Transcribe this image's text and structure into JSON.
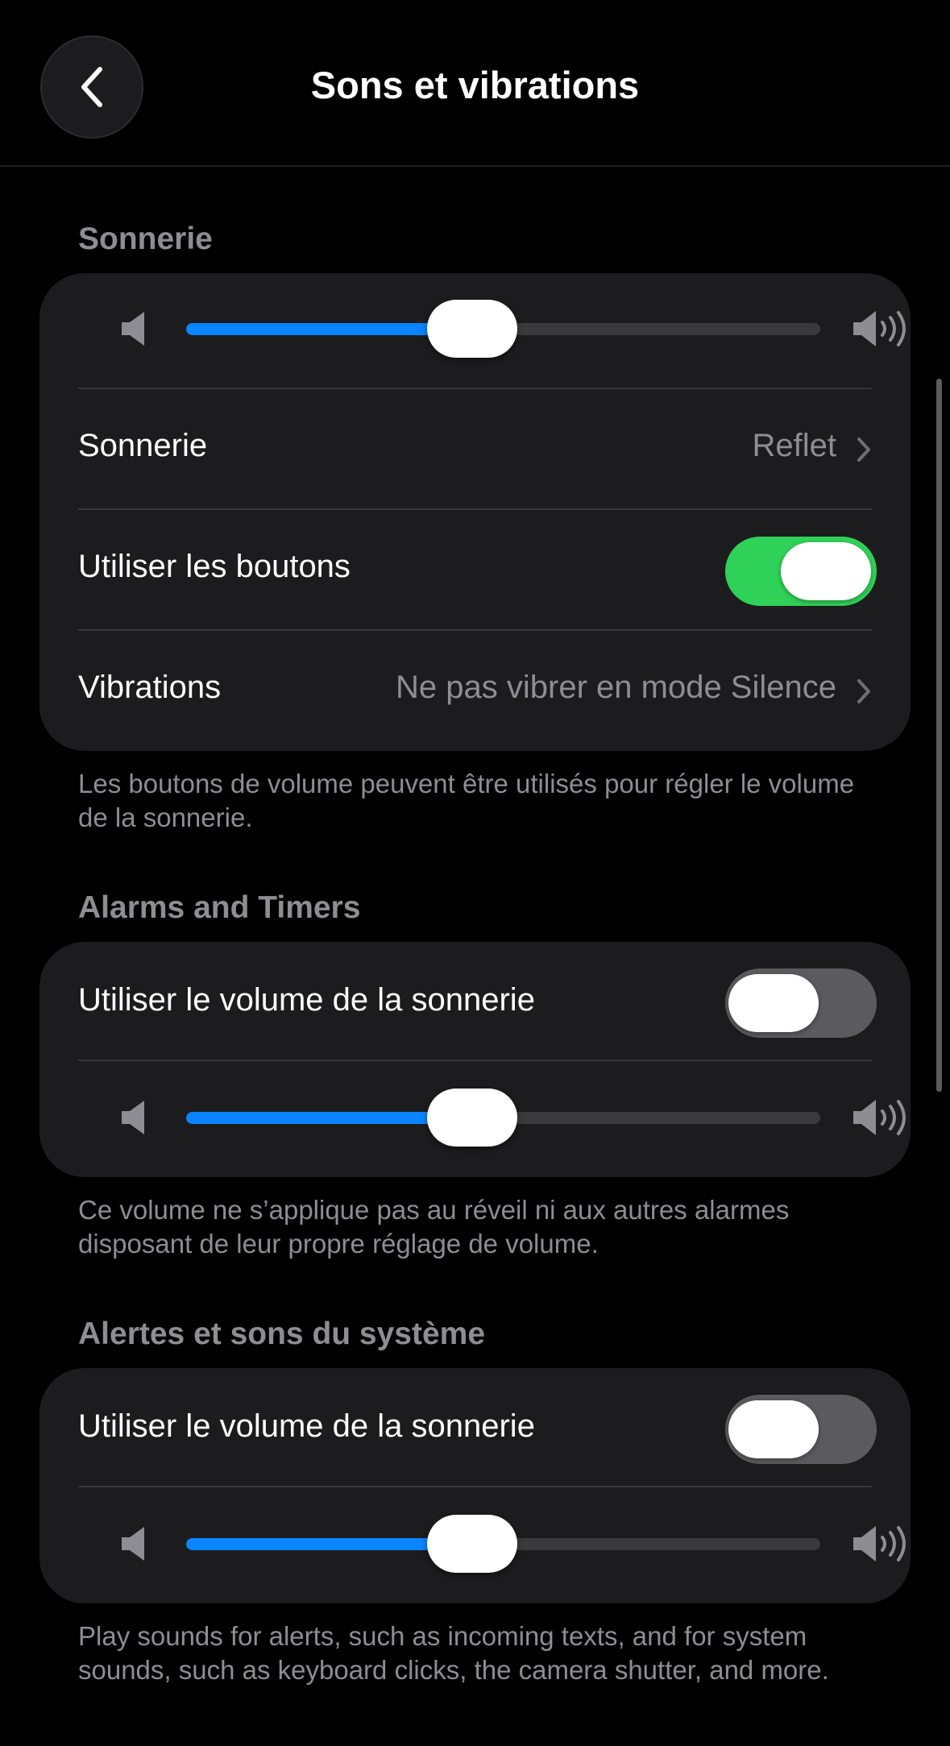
{
  "header": {
    "title": "Sons et vibrations",
    "back_icon": "chevron-left-icon"
  },
  "ringer": {
    "section_label": "Sonnerie",
    "volume_level": 0.38,
    "ringtone_label": "Sonnerie",
    "ringtone_value": "Reflet",
    "use_buttons_label": "Utiliser les boutons",
    "use_buttons_on": true,
    "vibrations_label": "Vibrations",
    "vibrations_value": "Ne pas vibrer en mode Silence",
    "footer": "Les boutons de volume peuvent être utilisés pour régler le volume de la sonnerie."
  },
  "alarms": {
    "section_label": "Alarms and Timers",
    "use_ringer_label": "Utiliser le volume de la sonnerie",
    "use_ringer_on": false,
    "volume_level": 0.38,
    "footer": "Ce volume ne s’applique pas au réveil ni aux autres alarmes disposant de leur propre réglage de volume."
  },
  "system": {
    "section_label": "Alertes et sons du système",
    "use_ringer_label": "Utiliser le volume de la sonnerie",
    "use_ringer_on": false,
    "volume_level": 0.38,
    "footer": "Play sounds for alerts, such as incoming texts, and for system sounds, such as keyboard clicks, the camera shutter, and more."
  },
  "colors": {
    "accent": "#0a84ff",
    "toggle_on": "#30d158",
    "toggle_off": "#5b5b5f",
    "card_bg": "#1c1c1e",
    "secondary_text": "#8d8d93"
  }
}
